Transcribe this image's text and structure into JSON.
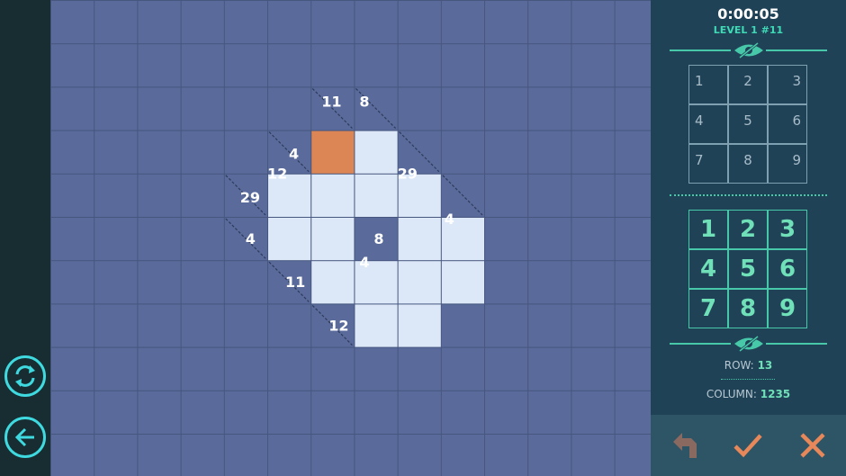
{
  "game": {
    "timer": "0:00:05",
    "level": "LEVEL 1 #11"
  },
  "board": {
    "grid_cols": 14,
    "grid_rows": 11,
    "background_color": "#5a6b9b",
    "line_color": "#46567e",
    "open_cell_color": "#dce8f8",
    "selected_cell_color": "#dc8555",
    "open_cells": [
      [
        6,
        3
      ],
      [
        7,
        3
      ],
      [
        5,
        4
      ],
      [
        6,
        4
      ],
      [
        7,
        4
      ],
      [
        8,
        4
      ],
      [
        5,
        5
      ],
      [
        6,
        5
      ],
      [
        8,
        5
      ],
      [
        9,
        5
      ],
      [
        6,
        6
      ],
      [
        7,
        6
      ],
      [
        8,
        6
      ],
      [
        9,
        6
      ],
      [
        7,
        7
      ],
      [
        8,
        7
      ]
    ],
    "selected_cell": [
      6,
      3
    ],
    "blocked_clue_cell": [
      7,
      5
    ],
    "clues": [
      {
        "text": "11",
        "col": 6,
        "row": 2
      },
      {
        "text": "8",
        "col": 7,
        "row": 2
      },
      {
        "text": "4",
        "col": 5,
        "row": 3
      },
      {
        "text": "12",
        "col": 5,
        "row": 3
      },
      {
        "text": "29",
        "col": 8,
        "row": 3
      },
      {
        "text": "29",
        "col": 4,
        "row": 4
      },
      {
        "text": "4",
        "col": 9,
        "row": 4
      },
      {
        "text": "4",
        "col": 4,
        "row": 5
      },
      {
        "text": "8",
        "col": 7,
        "row": 5
      },
      {
        "text": "4",
        "col": 7,
        "row": 5
      },
      {
        "text": "11",
        "col": 5,
        "row": 6
      },
      {
        "text": "12",
        "col": 6,
        "row": 7
      }
    ]
  },
  "reference_grid": [
    "1",
    "2",
    "3",
    "4",
    "5",
    "6",
    "7",
    "8",
    "9"
  ],
  "number_pad": [
    "1",
    "2",
    "3",
    "4",
    "5",
    "6",
    "7",
    "8",
    "9"
  ],
  "status": {
    "row_label": "ROW:",
    "row_value": "13",
    "column_label": "COLUMN:",
    "column_value": "1235"
  },
  "icons": {
    "restart": "restart-icon",
    "back": "back-arrow-icon",
    "toggle": "eye-slash-icon",
    "undo": "undo-icon",
    "confirm": "check-icon",
    "clear": "close-icon"
  },
  "colors": {
    "accent": "#47c8a8",
    "cyan": "#3fd9e0",
    "undo": "#8a6a60",
    "confirm": "#e8885a",
    "clear": "#e8885a"
  }
}
